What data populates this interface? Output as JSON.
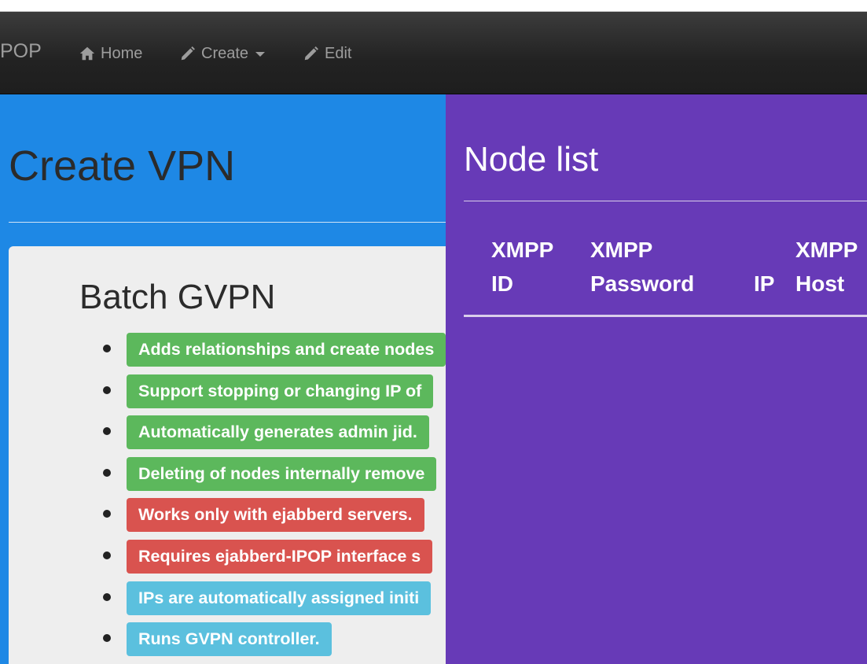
{
  "navbar": {
    "brand": "POP",
    "items": [
      {
        "label": "Home",
        "icon": "home-icon"
      },
      {
        "label": "Create",
        "icon": "pencil-icon",
        "dropdown": true
      },
      {
        "label": "Edit",
        "icon": "pencil-icon"
      }
    ]
  },
  "main": {
    "title": "Create VPN",
    "card": {
      "title": "Batch GVPN",
      "features": [
        {
          "text": "Adds relationships and create nodes",
          "type": "success"
        },
        {
          "text": "Support stopping or changing IP of",
          "type": "success"
        },
        {
          "text": "Automatically generates admin jid.",
          "type": "success"
        },
        {
          "text": "Deleting of nodes internally remove",
          "type": "success"
        },
        {
          "text": "Works only with ejabberd servers.",
          "type": "danger"
        },
        {
          "text": "Requires ejabberd-IPOP interface s",
          "type": "danger"
        },
        {
          "text": "IPs are automatically assigned initi",
          "type": "info"
        },
        {
          "text": "Runs GVPN controller.",
          "type": "info"
        }
      ]
    }
  },
  "node_list": {
    "title": "Node list",
    "columns": [
      {
        "line1": "XMPP",
        "line2": "ID"
      },
      {
        "line1": "XMPP",
        "line2": "Password"
      },
      {
        "line1": "",
        "line2": "IP"
      },
      {
        "line1": "XMPP",
        "line2": "Host"
      }
    ]
  },
  "colors": {
    "navbar": "#222222",
    "left_panel": "#1e88e5",
    "right_panel": "#673ab7",
    "card": "#eeeeee",
    "success": "#5cb85c",
    "danger": "#d9534f",
    "info": "#5bc0de"
  }
}
